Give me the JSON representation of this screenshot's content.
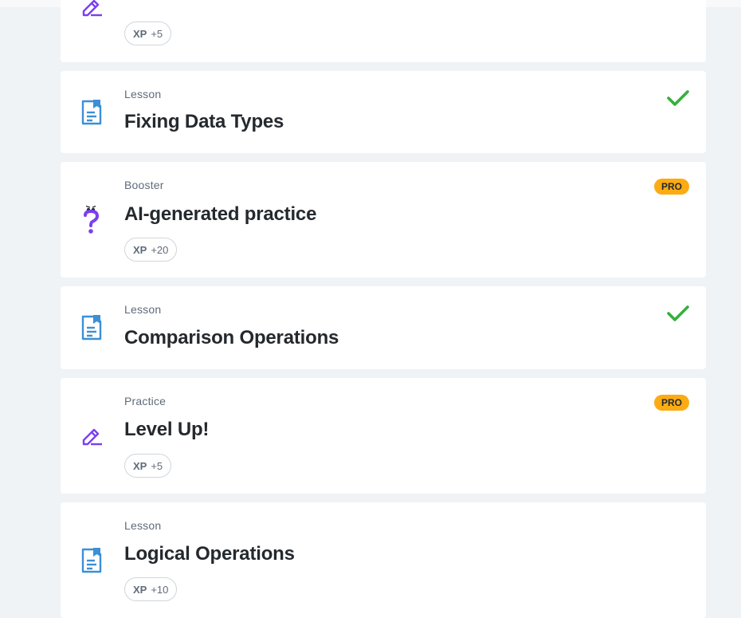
{
  "colors": {
    "background": "#eff3f6",
    "card": "#ffffff",
    "lesson_icon": "#3d8fd6",
    "practice_icon": "#7b3ff0",
    "check": "#35b03a",
    "pro_badge": "#fcab13"
  },
  "items": [
    {
      "kind": "",
      "title": "",
      "xp_label": "XP",
      "xp_value": "+5",
      "icon": "pencil-icon"
    },
    {
      "kind": "Lesson",
      "title": "Fixing Data Types",
      "icon": "lesson-document-icon",
      "completed": true
    },
    {
      "kind": "Booster",
      "title": "AI-generated practice",
      "xp_label": "XP",
      "xp_value": "+20",
      "pro": "PRO",
      "icon": "question-mark-icon"
    },
    {
      "kind": "Lesson",
      "title": "Comparison Operations",
      "icon": "lesson-document-icon",
      "completed": true
    },
    {
      "kind": "Practice",
      "title": "Level Up!",
      "xp_label": "XP",
      "xp_value": "+5",
      "pro": "PRO",
      "icon": "pencil-icon"
    },
    {
      "kind": "Lesson",
      "title": "Logical Operations",
      "xp_label": "XP",
      "xp_value": "+10",
      "icon": "lesson-document-icon"
    }
  ]
}
